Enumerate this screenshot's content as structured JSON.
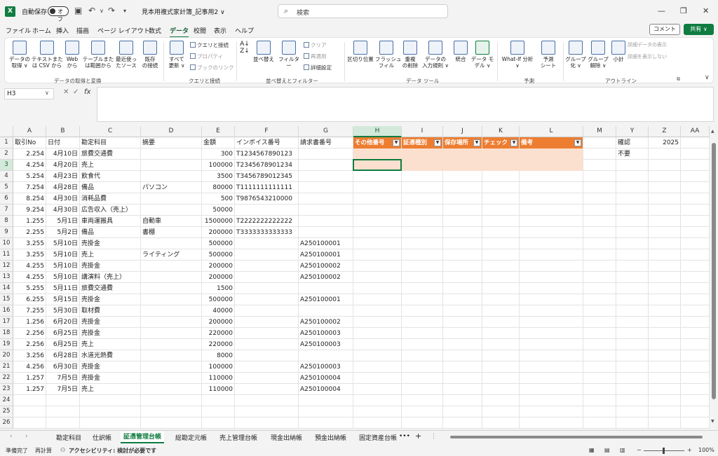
{
  "titlebar": {
    "app_icon": "X",
    "autosave_label": "自動保存",
    "autosave_state": "オフ",
    "doc_title": "見本用複式家計簿_記事用2 ∨",
    "search_placeholder": "検索"
  },
  "menu": [
    "ファイル",
    "ホーム",
    "挿入",
    "描画",
    "ページ レイアウト",
    "数式",
    "データ",
    "校閲",
    "表示",
    "ヘルプ"
  ],
  "menu_active": "データ",
  "buttons": {
    "comment": "コメント",
    "share": "共有"
  },
  "ribbon": {
    "get_data": [
      "データの\n取得 ∨",
      "テキストまた\nは CSV から",
      "Web\nから",
      "テーブルまた\nは範囲から",
      "最近使っ\nたソース",
      "既存\nの接続"
    ],
    "refresh": "すべて\n更新 ∨",
    "query_small": [
      "クエリと接続",
      "プロパティ",
      "ブックのリンク"
    ],
    "sort_filter": [
      "並べ替え",
      "フィルター"
    ],
    "sort_small": [
      "クリア",
      "再適用",
      "詳細設定"
    ],
    "data_tools": [
      "区切り位置",
      "フラッシュ\nフィル",
      "重複\nの削除",
      "データの\n入力規則 ∨",
      "統合",
      "データ モ\nデル ∨"
    ],
    "forecast": [
      "What-If 分析\n∨",
      "予測\nシート"
    ],
    "outline": [
      "グループ\n化 ∨",
      "グループ\n解除 ∨",
      "小計"
    ],
    "outline_small": [
      "詳細データの表示",
      "詳細を表示しない"
    ],
    "groups": [
      "データの取得と変換",
      "クエリと接続",
      "並べ替えとフィルター",
      "データ ツール",
      "予測",
      "アウトライン"
    ]
  },
  "namebox": "H3",
  "columns": [
    "A",
    "B",
    "C",
    "D",
    "E",
    "F",
    "G",
    "H",
    "I",
    "J",
    "K",
    "L",
    "M",
    "Y",
    "Z",
    "AA"
  ],
  "selected_column": "H",
  "selected_row": 3,
  "rows": [
    {
      "n": 1,
      "a": "取引No",
      "b": "日付",
      "c": "勘定科目",
      "d": "摘要",
      "e": "金額",
      "f": "インボイス番号",
      "g": "請求書番号",
      "y": "確認",
      "z": "2025"
    },
    {
      "n": 2,
      "a": "2.254",
      "b": "4月10日",
      "c": "旅費交通費",
      "d": "",
      "e": "300",
      "f": "T1234567890123",
      "g": "",
      "y": "不要",
      "z": ""
    },
    {
      "n": 3,
      "a": "4.254",
      "b": "4月20日",
      "c": "売上",
      "d": "",
      "e": "100000",
      "f": "T2345678901234",
      "g": "",
      "y": "",
      "z": ""
    },
    {
      "n": 4,
      "a": "5.254",
      "b": "4月23日",
      "c": "飲食代",
      "d": "",
      "e": "3500",
      "f": "T3456789012345",
      "g": "",
      "y": "",
      "z": ""
    },
    {
      "n": 5,
      "a": "7.254",
      "b": "4月28日",
      "c": "備品",
      "d": "パソコン",
      "e": "80000",
      "f": "T1111111111111",
      "g": "",
      "y": "",
      "z": ""
    },
    {
      "n": 6,
      "a": "8.254",
      "b": "4月30日",
      "c": "消耗品費",
      "d": "",
      "e": "500",
      "f": "T9876543210000",
      "g": "",
      "y": "",
      "z": ""
    },
    {
      "n": 7,
      "a": "9.254",
      "b": "4月30日",
      "c": "広告収入（売上）",
      "d": "",
      "e": "50000",
      "f": "",
      "g": "",
      "y": "",
      "z": ""
    },
    {
      "n": 8,
      "a": "1.255",
      "b": "5月1日",
      "c": "車両運搬具",
      "d": "自動車",
      "e": "1500000",
      "f": "T2222222222222",
      "g": "",
      "y": "",
      "z": ""
    },
    {
      "n": 9,
      "a": "2.255",
      "b": "5月2日",
      "c": "備品",
      "d": "書棚",
      "e": "200000",
      "f": "T3333333333333",
      "g": "",
      "y": "",
      "z": ""
    },
    {
      "n": 10,
      "a": "3.255",
      "b": "5月10日",
      "c": "売掛金",
      "d": "",
      "e": "500000",
      "f": "",
      "g": "A250100001",
      "y": "",
      "z": ""
    },
    {
      "n": 11,
      "a": "3.255",
      "b": "5月10日",
      "c": "売上",
      "d": "ライティング",
      "e": "500000",
      "f": "",
      "g": "A250100001",
      "y": "",
      "z": ""
    },
    {
      "n": 12,
      "a": "4.255",
      "b": "5月10日",
      "c": "売掛金",
      "d": "",
      "e": "200000",
      "f": "",
      "g": "A250100002",
      "y": "",
      "z": ""
    },
    {
      "n": 13,
      "a": "4.255",
      "b": "5月10日",
      "c": "講演料（売上）",
      "d": "",
      "e": "200000",
      "f": "",
      "g": "A250100002",
      "y": "",
      "z": ""
    },
    {
      "n": 14,
      "a": "5.255",
      "b": "5月11日",
      "c": "旅費交通費",
      "d": "",
      "e": "1500",
      "f": "",
      "g": "",
      "y": "",
      "z": ""
    },
    {
      "n": 15,
      "a": "6.255",
      "b": "5月15日",
      "c": "売掛金",
      "d": "",
      "e": "500000",
      "f": "",
      "g": "A250100001",
      "y": "",
      "z": ""
    },
    {
      "n": 16,
      "a": "7.255",
      "b": "5月30日",
      "c": "取材費",
      "d": "",
      "e": "40000",
      "f": "",
      "g": "",
      "y": "",
      "z": ""
    },
    {
      "n": 17,
      "a": "1.256",
      "b": "6月20日",
      "c": "売掛金",
      "d": "",
      "e": "200000",
      "f": "",
      "g": "A250100002",
      "y": "",
      "z": ""
    },
    {
      "n": 18,
      "a": "2.256",
      "b": "6月25日",
      "c": "売掛金",
      "d": "",
      "e": "220000",
      "f": "",
      "g": "A250100003",
      "y": "",
      "z": ""
    },
    {
      "n": 19,
      "a": "2.256",
      "b": "6月25日",
      "c": "売上",
      "d": "",
      "e": "220000",
      "f": "",
      "g": "A250100003",
      "y": "",
      "z": ""
    },
    {
      "n": 20,
      "a": "3.256",
      "b": "6月28日",
      "c": "水道光熱費",
      "d": "",
      "e": "8000",
      "f": "",
      "g": "",
      "y": "",
      "z": ""
    },
    {
      "n": 21,
      "a": "4.256",
      "b": "6月30日",
      "c": "売掛金",
      "d": "",
      "e": "100000",
      "f": "",
      "g": "A250100003",
      "y": "",
      "z": ""
    },
    {
      "n": 22,
      "a": "1.257",
      "b": "7月5日",
      "c": "売掛金",
      "d": "",
      "e": "110000",
      "f": "",
      "g": "A250100004",
      "y": "",
      "z": ""
    },
    {
      "n": 23,
      "a": "1.257",
      "b": "7月5日",
      "c": "売上",
      "d": "",
      "e": "110000",
      "f": "",
      "g": "A250100004",
      "y": "",
      "z": ""
    },
    {
      "n": 24
    },
    {
      "n": 25
    },
    {
      "n": 26
    }
  ],
  "table_headers": [
    "その他番号",
    "証憑種別",
    "保存場所",
    "チェック",
    "備考"
  ],
  "sheet_tabs": [
    "勘定科目",
    "仕訳帳",
    "証憑管理台帳",
    "総勘定元帳",
    "売上管理台帳",
    "現金出納帳",
    "預金出納帳",
    "固定資産台帳"
  ],
  "active_tab": "証憑管理台帳",
  "tab_more": "•••",
  "tab_add": "+",
  "status": {
    "ready": "準備完了",
    "recalc": "再計算",
    "accessibility": "アクセシビリティ: 検討が必要です",
    "zoom": "100%"
  }
}
